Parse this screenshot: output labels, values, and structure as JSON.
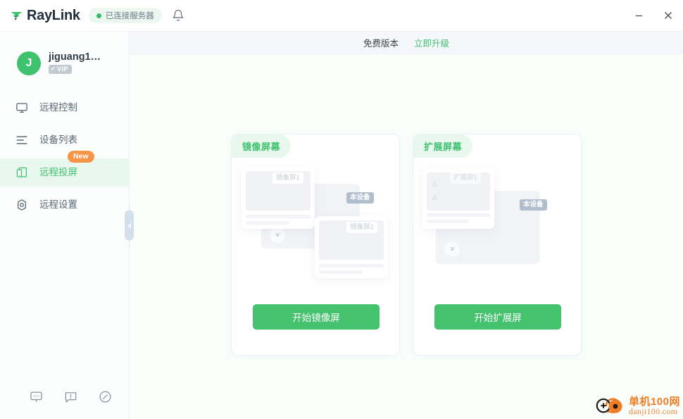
{
  "window": {
    "app_name": "RayLink",
    "logo_icon": "raylink-arrow-logo",
    "status_text": "已连接服务器",
    "status_dot_color": "#35bb6a",
    "bell_icon": "notification-bell-icon",
    "minimize_label": "–",
    "close_label": "×"
  },
  "sidebar": {
    "profile": {
      "avatar_initial": "J",
      "username": "jiguang1…",
      "vip_badge": "VIP",
      "vip_check": "✔"
    },
    "items": [
      {
        "label": "远程控制",
        "icon": "monitor-icon",
        "active": false,
        "badge": ""
      },
      {
        "label": "设备列表",
        "icon": "device-list-icon",
        "active": false,
        "badge": ""
      },
      {
        "label": "远程投屏",
        "icon": "screen-cast-icon",
        "active": true,
        "badge": "New"
      },
      {
        "label": "远程设置",
        "icon": "gear-icon",
        "active": false,
        "badge": ""
      }
    ],
    "bottom_icons": [
      {
        "name": "chat-icon"
      },
      {
        "name": "feedback-icon"
      },
      {
        "name": "compass-icon"
      }
    ],
    "collapse_handle_icon": "chevron-left-icon"
  },
  "topbar": {
    "free_label": "免费版本",
    "upgrade_label": "立即升级"
  },
  "cards": [
    {
      "tab_label": "镜像屏幕",
      "button_label": "开始镜像屏",
      "preview": {
        "host_tag": "本设备",
        "screen_tags": [
          "镜像屏1",
          "镜像屏2"
        ],
        "logo_badge_icon": "raylink-small-logo"
      }
    },
    {
      "tab_label": "扩展屏幕",
      "button_label": "开始扩展屏",
      "preview": {
        "host_tag": "本设备",
        "screen_tags": [
          "扩展屏1"
        ],
        "logo_badge_icon": "raylink-small-logo",
        "image_placeholder_icon": "mountain-image-icon"
      }
    }
  ],
  "watermark": {
    "logo_icon": "danji100-logo",
    "title": "单机100网",
    "url": "danji100.com",
    "color": "#f07d25"
  },
  "colors": {
    "brand_green": "#3ec26e",
    "button_green": "#44c26d",
    "new_badge_orange": "#f79547",
    "text_dark": "#33404d",
    "text_muted": "#5a6875"
  }
}
